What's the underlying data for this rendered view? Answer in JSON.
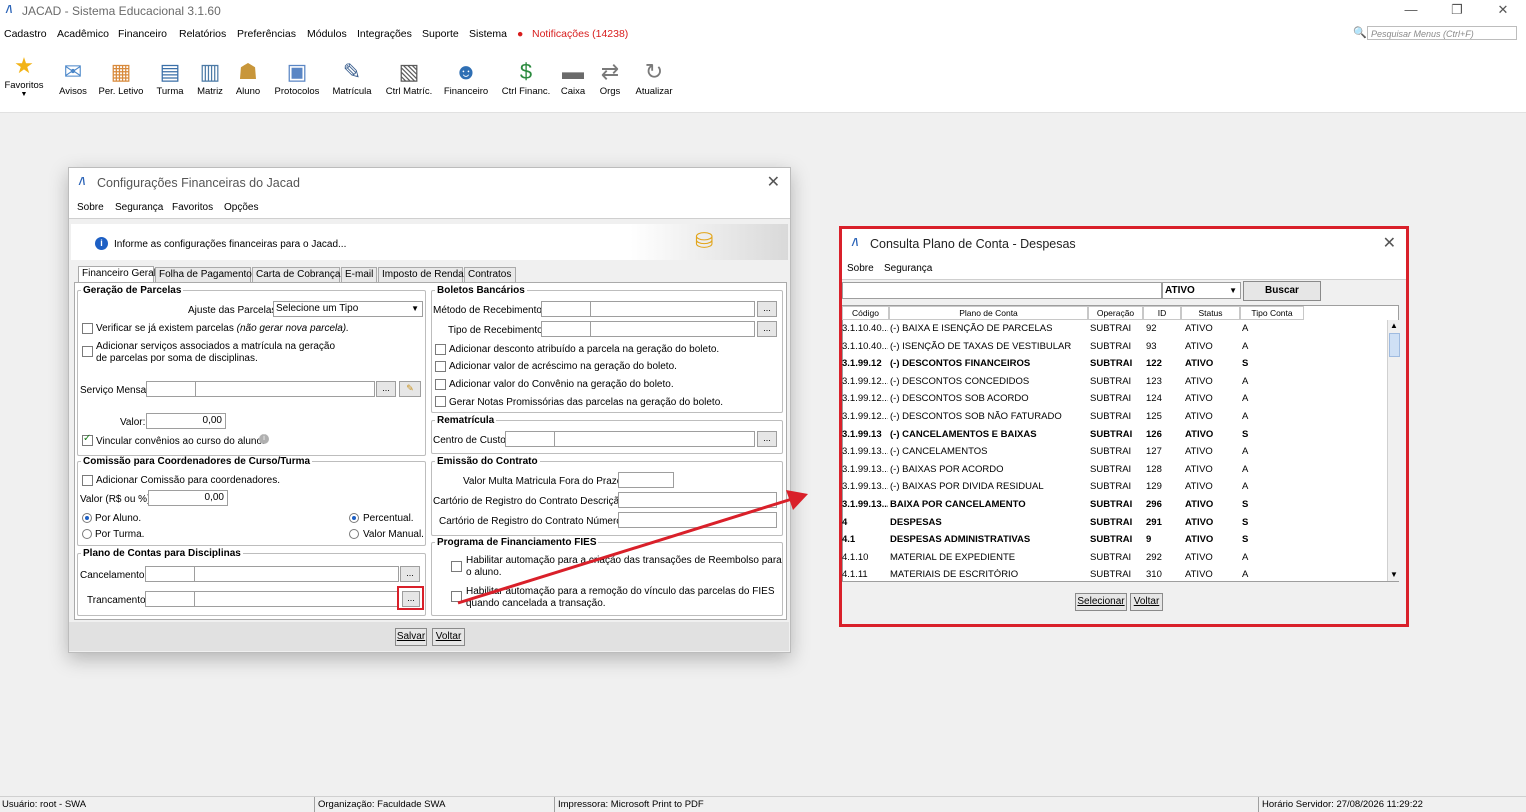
{
  "app": {
    "title": "JACAD - Sistema Educacional 3.1.60"
  },
  "menubar": {
    "items": [
      "Cadastro",
      "Acadêmico",
      "Financeiro",
      "Relatórios",
      "Preferências",
      "Módulos",
      "Integrações",
      "Suporte",
      "Sistema"
    ],
    "notifications": "Notificações (14238)",
    "search_placeholder": "Pesquisar Menus (Ctrl+F)"
  },
  "toolbar": {
    "buttons": [
      {
        "label": "Favoritos",
        "icon": "star-icon",
        "color": "#f2b316"
      },
      {
        "label": "Avisos",
        "icon": "envelope-icon",
        "color": "#4b87c9"
      },
      {
        "label": "Per. Letivo",
        "icon": "calendar-icon",
        "color": "#d88a3c"
      },
      {
        "label": "Turma",
        "icon": "class-icon",
        "color": "#3b6fa8"
      },
      {
        "label": "Matriz",
        "icon": "matrix-icon",
        "color": "#4c7aa6"
      },
      {
        "label": "Aluno",
        "icon": "student-icon",
        "color": "#c8963a"
      },
      {
        "label": "Protocolos",
        "icon": "protocol-icon",
        "color": "#5a86c4"
      },
      {
        "label": "Matrícula",
        "icon": "enrollment-icon",
        "color": "#3a5f8f"
      },
      {
        "label": "Ctrl Matríc.",
        "icon": "control-enrollment-icon",
        "color": "#5b5b5b"
      },
      {
        "label": "Financeiro",
        "icon": "finance-icon",
        "color": "#2f6fb4"
      },
      {
        "label": "Ctrl Financ.",
        "icon": "money-icon",
        "color": "#2b8a3e"
      },
      {
        "label": "Caixa",
        "icon": "cash-register-icon",
        "color": "#6a6a6a"
      },
      {
        "label": "Orgs",
        "icon": "swap-icon",
        "color": "#7a7a7a"
      },
      {
        "label": "Atualizar",
        "icon": "refresh-icon",
        "color": "#7a7a7a"
      }
    ]
  },
  "config_window": {
    "title": "Configurações Financeiras do Jacad",
    "menu": [
      "Sobre",
      "Segurança",
      "Favoritos",
      "Opções"
    ],
    "info": "Informe as configurações financeiras para o Jacad...",
    "tabs": [
      "Financeiro Geral",
      "Folha de Pagamento",
      "Carta de Cobrança",
      "E-mail",
      "Imposto de Renda",
      "Contratos"
    ],
    "geracao": {
      "legend": "Geração de Parcelas",
      "ajuste_label": "Ajuste das Parcelas:",
      "ajuste_value": "Selecione um Tipo",
      "verificar_label": "Verificar se já existem parcelas",
      "verificar_note": "(não gerar nova parcela).",
      "adicionar_label_1": "Adicionar serviços associados a matrícula na geração",
      "adicionar_label_2": "de parcelas por soma de disciplinas.",
      "servico_label": "Serviço Mensal:",
      "valor_label": "Valor:",
      "valor_value": "0,00",
      "vincular_label": "Vincular convênios ao curso do aluno."
    },
    "comissao": {
      "legend": "Comissão para Coordenadores de Curso/Turma",
      "adicionar_label": "Adicionar Comissão para coordenadores.",
      "valor_label": "Valor (R$ ou %):",
      "valor_value": "0,00",
      "por_aluno": "Por Aluno.",
      "por_turma": "Por Turma.",
      "percentual": "Percentual.",
      "valor_manual": "Valor Manual."
    },
    "plano": {
      "legend": "Plano de Contas para Disciplinas",
      "cancelamento_label": "Cancelamento:",
      "trancamento_label": "Trancamento:"
    },
    "boletos": {
      "legend": "Boletos Bancários",
      "metodo_label": "Método de Recebimento:",
      "tipo_label": "Tipo de Recebimento:",
      "opt1": "Adicionar desconto atribuído a parcela na geração do boleto.",
      "opt2": "Adicionar valor de acréscimo na geração do boleto.",
      "opt3": "Adicionar valor do Convênio na geração do boleto.",
      "opt4": "Gerar Notas Promissórias das parcelas na geração do boleto."
    },
    "rematricula": {
      "legend": "Rematrícula",
      "centro_label": "Centro de Custo:"
    },
    "emissao": {
      "legend": "Emissão do Contrato",
      "multa_label": "Valor Multa Matricula Fora do Prazo:",
      "cartorio_desc_label": "Cartório de Registro do Contrato Descrição:",
      "cartorio_num_label": "Cartório de Registro do Contrato Número:"
    },
    "fies": {
      "legend": "Programa de Financiamento FIES",
      "opt1_a": "Habilitar automação para a criação das transações de Reembolso para",
      "opt1_b": "o aluno.",
      "opt2_a": "Habilitar automação para a remoção do vínculo das parcelas do FIES",
      "opt2_b": "quando cancelada a transação."
    },
    "buttons": {
      "salvar": "Salvar",
      "voltar": "Voltar"
    },
    "ellipsis": "..."
  },
  "consulta_window": {
    "title": "Consulta Plano de Conta - Despesas",
    "menu": [
      "Sobre",
      "Segurança"
    ],
    "status_filter": "ATIVO",
    "buscar": "Buscar",
    "columns": [
      "Código",
      "Plano de Conta",
      "Operação",
      "ID",
      "Status",
      "Tipo Conta"
    ],
    "rows": [
      {
        "codigo": "3.1.10.40....",
        "plano": "(-) BAIXA E ISENÇÃO DE PARCELAS",
        "operacao": "SUBTRAI",
        "id": "92",
        "status": "ATIVO",
        "tipo": "A",
        "bold": false
      },
      {
        "codigo": "3.1.10.40....",
        "plano": "(-) ISENÇÃO DE TAXAS DE VESTIBULAR",
        "operacao": "SUBTRAI",
        "id": "93",
        "status": "ATIVO",
        "tipo": "A",
        "bold": false
      },
      {
        "codigo": "3.1.99.12",
        "plano": "(-) DESCONTOS FINANCEIROS",
        "operacao": "SUBTRAI",
        "id": "122",
        "status": "ATIVO",
        "tipo": "S",
        "bold": true
      },
      {
        "codigo": "3.1.99.12....",
        "plano": "(-) DESCONTOS CONCEDIDOS",
        "operacao": "SUBTRAI",
        "id": "123",
        "status": "ATIVO",
        "tipo": "A",
        "bold": false
      },
      {
        "codigo": "3.1.99.12....",
        "plano": "(-) DESCONTOS SOB ACORDO",
        "operacao": "SUBTRAI",
        "id": "124",
        "status": "ATIVO",
        "tipo": "A",
        "bold": false
      },
      {
        "codigo": "3.1.99.12....",
        "plano": "(-) DESCONTOS SOB NÃO FATURADO",
        "operacao": "SUBTRAI",
        "id": "125",
        "status": "ATIVO",
        "tipo": "A",
        "bold": false
      },
      {
        "codigo": "3.1.99.13",
        "plano": "(-) CANCELAMENTOS E BAIXAS",
        "operacao": "SUBTRAI",
        "id": "126",
        "status": "ATIVO",
        "tipo": "S",
        "bold": true
      },
      {
        "codigo": "3.1.99.13....",
        "plano": "(-) CANCELAMENTOS",
        "operacao": "SUBTRAI",
        "id": "127",
        "status": "ATIVO",
        "tipo": "A",
        "bold": false
      },
      {
        "codigo": "3.1.99.13....",
        "plano": "(-) BAIXAS POR ACORDO",
        "operacao": "SUBTRAI",
        "id": "128",
        "status": "ATIVO",
        "tipo": "A",
        "bold": false
      },
      {
        "codigo": "3.1.99.13....",
        "plano": "(-) BAIXAS POR DIVIDA RESIDUAL",
        "operacao": "SUBTRAI",
        "id": "129",
        "status": "ATIVO",
        "tipo": "A",
        "bold": false
      },
      {
        "codigo": "3.1.99.13....",
        "plano": "BAIXA POR CANCELAMENTO",
        "operacao": "SUBTRAI",
        "id": "296",
        "status": "ATIVO",
        "tipo": "S",
        "bold": true
      },
      {
        "codigo": "4",
        "plano": "DESPESAS",
        "operacao": "SUBTRAI",
        "id": "291",
        "status": "ATIVO",
        "tipo": "S",
        "bold": true
      },
      {
        "codigo": "4.1",
        "plano": "DESPESAS ADMINISTRATIVAS",
        "operacao": "SUBTRAI",
        "id": "9",
        "status": "ATIVO",
        "tipo": "S",
        "bold": true
      },
      {
        "codigo": "4.1.10",
        "plano": "MATERIAL DE EXPEDIENTE",
        "operacao": "SUBTRAI",
        "id": "292",
        "status": "ATIVO",
        "tipo": "A",
        "bold": false
      },
      {
        "codigo": "4.1.11",
        "plano": "MATERIAIS DE ESCRITÓRIO",
        "operacao": "SUBTRAI",
        "id": "310",
        "status": "ATIVO",
        "tipo": "A",
        "bold": false
      }
    ],
    "buttons": {
      "selecionar": "Selecionar",
      "voltar": "Voltar"
    }
  },
  "statusbar": {
    "usuario": "Usuário: root - SWA",
    "organizacao": "Organização: Faculdade SWA",
    "impressora": "Impressora: Microsoft Print to PDF",
    "horario": "Horário Servidor: 27/08/2026 11:29:22"
  },
  "colors": {
    "highlight": "#d9202a",
    "accent": "#2a63b7",
    "notification": "#d81d1d"
  }
}
